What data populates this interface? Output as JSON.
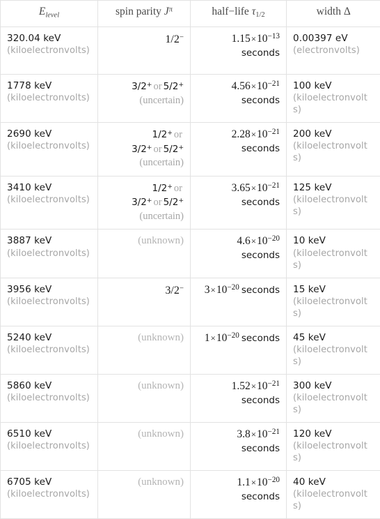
{
  "table": {
    "headers": [
      {
        "text": "E",
        "sub": "level",
        "name": "header-energy-level"
      },
      {
        "text": "spin parity",
        "var": "J",
        "sup": "π",
        "name": "header-spin-parity"
      },
      {
        "text": "half−life",
        "var": "τ",
        "sub": "1/2",
        "name": "header-half-life"
      },
      {
        "text": "width",
        "var": "Δ",
        "name": "header-width"
      }
    ],
    "header_labels": {
      "energy": "E",
      "energy_sub": "level",
      "spin": "spin parity",
      "spin_var": "J",
      "spin_sup": "π",
      "halflife": "half−life",
      "halflife_var": "τ",
      "halflife_sub": "1/2",
      "width": "width",
      "width_var": "Δ"
    },
    "rows": [
      {
        "level_value": "320.04 keV",
        "level_unit": "(kiloelectronvolts)",
        "spin_kind": "known",
        "spin_values": [
          {
            "j": "1/2",
            "parity": "−"
          }
        ],
        "spin_note": "",
        "half_mantissa": "1.15",
        "half_exponent": "−13",
        "half_unit": "seconds",
        "half_wrap": true,
        "width_value": "0.00397 eV",
        "width_unit": "(electronvolts)"
      },
      {
        "level_value": "1778 keV",
        "level_unit": "(kiloelectronvolts)",
        "spin_kind": "uncertain",
        "spin_values": [
          {
            "j": "3/2",
            "parity": "+"
          },
          {
            "j": "5/2",
            "parity": "+"
          }
        ],
        "spin_note": "(uncertain)",
        "half_mantissa": "4.56",
        "half_exponent": "−21",
        "half_unit": "seconds",
        "half_wrap": true,
        "width_value": "100 keV",
        "width_unit": "(kiloelectronvolts)"
      },
      {
        "level_value": "2690 keV",
        "level_unit": "(kiloelectronvolts)",
        "spin_kind": "uncertain",
        "spin_values": [
          {
            "j": "1/2",
            "parity": "+"
          },
          {
            "j": "3/2",
            "parity": "+"
          },
          {
            "j": "5/2",
            "parity": "+"
          }
        ],
        "spin_note": "(uncertain)",
        "half_mantissa": "2.28",
        "half_exponent": "−21",
        "half_unit": "seconds",
        "half_wrap": true,
        "width_value": "200 keV",
        "width_unit": "(kiloelectronvolts)"
      },
      {
        "level_value": "3410 keV",
        "level_unit": "(kiloelectronvolts)",
        "spin_kind": "uncertain",
        "spin_values": [
          {
            "j": "1/2",
            "parity": "+"
          },
          {
            "j": "3/2",
            "parity": "+"
          },
          {
            "j": "5/2",
            "parity": "+"
          }
        ],
        "spin_note": "(uncertain)",
        "half_mantissa": "3.65",
        "half_exponent": "−21",
        "half_unit": "seconds",
        "half_wrap": true,
        "width_value": "125 keV",
        "width_unit": "(kiloelectronvolts)"
      },
      {
        "level_value": "3887 keV",
        "level_unit": "(kiloelectronvolts)",
        "spin_kind": "unknown",
        "spin_values": [],
        "spin_note": "(unknown)",
        "half_mantissa": "4.6",
        "half_exponent": "−20",
        "half_unit": "seconds",
        "half_wrap": true,
        "width_value": "10 keV",
        "width_unit": "(kiloelectronvolts)"
      },
      {
        "level_value": "3956 keV",
        "level_unit": "(kiloelectronvolts)",
        "spin_kind": "known",
        "spin_values": [
          {
            "j": "3/2",
            "parity": "−"
          }
        ],
        "spin_note": "",
        "half_mantissa": "3",
        "half_exponent": "−20",
        "half_unit": "seconds",
        "half_wrap": false,
        "width_value": "15 keV",
        "width_unit": "(kiloelectronvolts)"
      },
      {
        "level_value": "5240 keV",
        "level_unit": "(kiloelectronvolts)",
        "spin_kind": "unknown",
        "spin_values": [],
        "spin_note": "(unknown)",
        "half_mantissa": "1",
        "half_exponent": "−20",
        "half_unit": "seconds",
        "half_wrap": false,
        "width_value": "45 keV",
        "width_unit": "(kiloelectronvolts)"
      },
      {
        "level_value": "5860 keV",
        "level_unit": "(kiloelectronvolts)",
        "spin_kind": "unknown",
        "spin_values": [],
        "spin_note": "(unknown)",
        "half_mantissa": "1.52",
        "half_exponent": "−21",
        "half_unit": "seconds",
        "half_wrap": true,
        "width_value": "300 keV",
        "width_unit": "(kiloelectronvolts)"
      },
      {
        "level_value": "6510 keV",
        "level_unit": "(kiloelectronvolts)",
        "spin_kind": "unknown",
        "spin_values": [],
        "spin_note": "(unknown)",
        "half_mantissa": "3.8",
        "half_exponent": "−21",
        "half_unit": "seconds",
        "half_wrap": true,
        "width_value": "120 keV",
        "width_unit": "(kiloelectronvolts)"
      },
      {
        "level_value": "6705 keV",
        "level_unit": "(kiloelectronvolts)",
        "spin_kind": "unknown",
        "spin_values": [],
        "spin_note": "(unknown)",
        "half_mantissa": "1.1",
        "half_exponent": "−20",
        "half_unit": "seconds",
        "half_wrap": true,
        "width_value": "40 keV",
        "width_unit": "(kiloelectronvolts)"
      }
    ],
    "separator_or": "or",
    "multiply_symbol": "×",
    "base_ten": "10"
  },
  "colors": {
    "text": "#1a1a1a",
    "muted": "#a6a6a6",
    "header": "#4a4a4a",
    "border": "#e2e2e2",
    "background": "#ffffff"
  }
}
